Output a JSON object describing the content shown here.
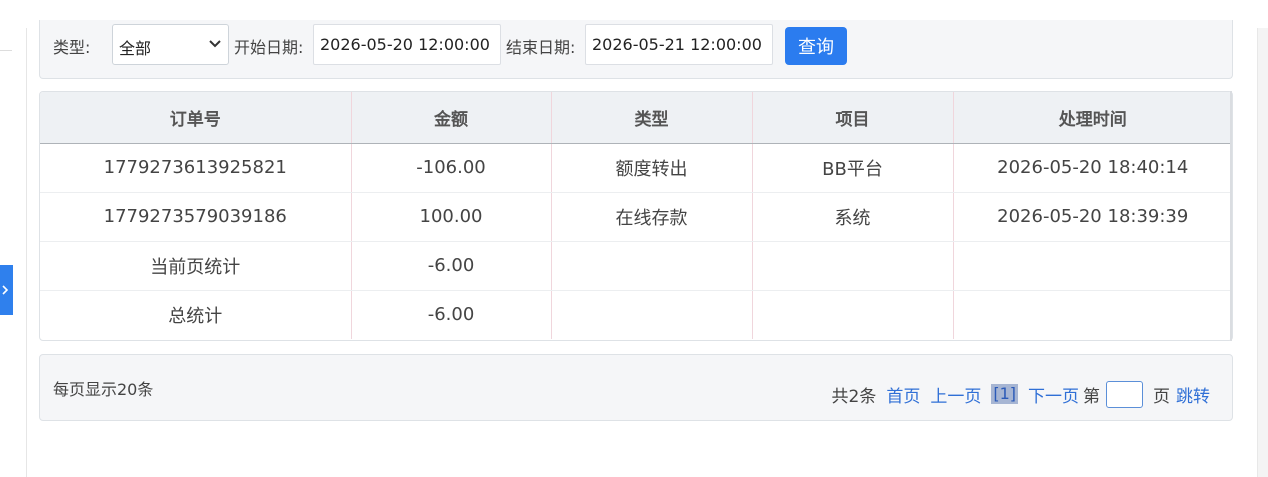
{
  "filters": {
    "type_label": "类型:",
    "type_selected": "全部",
    "start_label": "开始日期:",
    "start_value": "2026-05-20 12:00:00",
    "end_label": "结束日期:",
    "end_value": "2026-05-21 12:00:00",
    "query_button": "查询"
  },
  "table": {
    "headers": [
      "订单号",
      "金额",
      "类型",
      "项目",
      "处理时间"
    ],
    "rows": [
      [
        "1779273613925821",
        "-106.00",
        "额度转出",
        "BB平台",
        "2026-05-20 18:40:14"
      ],
      [
        "1779273579039186",
        "100.00",
        "在线存款",
        "系统",
        "2026-05-20 18:39:39"
      ],
      [
        "当前页统计",
        "-6.00",
        "",
        "",
        ""
      ],
      [
        "总统计",
        "-6.00",
        "",
        "",
        ""
      ]
    ]
  },
  "pager": {
    "per_page": "每页显示20条",
    "total": "共2条",
    "first": "首页",
    "prev": "上一页",
    "current": "[1]",
    "next": "下一页",
    "page_prefix": "第",
    "page_suffix": "页",
    "jump": "跳转"
  },
  "colors": {
    "accent": "#2b7cef",
    "link": "#2f6fd6"
  },
  "icons": {
    "select_arrow": "chevron-down-icon",
    "side_toggle": "chevron-right-icon"
  }
}
